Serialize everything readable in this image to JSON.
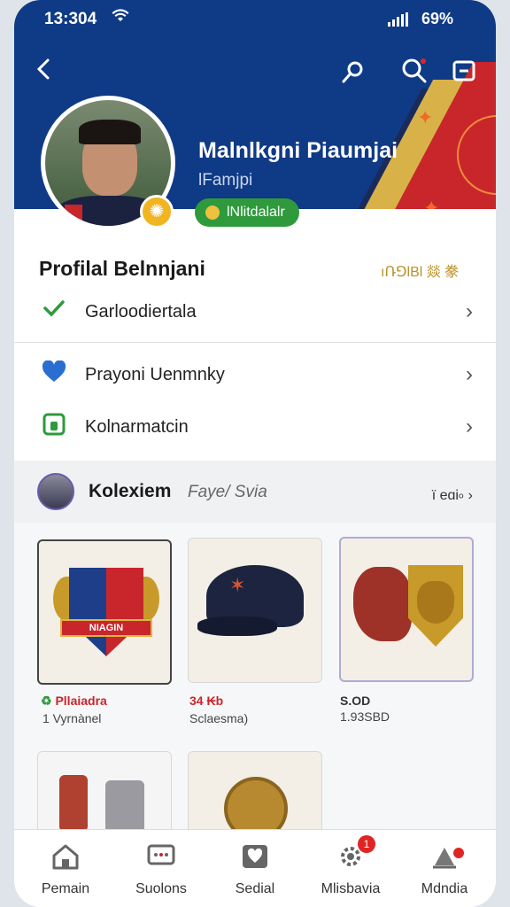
{
  "status_bar": {
    "time": "13:304",
    "battery": "69%"
  },
  "header": {
    "name": "Malnlkgni Piaumjai",
    "handle": "lFamjpi",
    "status_pill": "lNlitdalalr"
  },
  "profile_section": {
    "title": "Profilal Belnnjani",
    "meta": "ıՌ⅁lΒl 燚 豢",
    "items": [
      {
        "label": "Garloodiertala",
        "icon": "check-icon"
      },
      {
        "label": "Prayoni Uenmnky",
        "icon": "heart-icon"
      },
      {
        "label": "Kolnarmatcin",
        "icon": "lock-icon"
      }
    ]
  },
  "collection": {
    "title": "Kolexiem",
    "subtitle": "Faye/ Svia",
    "more": "ï eɑi৹"
  },
  "items": [
    {
      "price": "Pllaiadra",
      "name": "1  Vyrnànel",
      "price_color": "#c8262b"
    },
    {
      "price": "34 ₭b",
      "name": "Sclaesma)",
      "price_color": "#c8262b"
    },
    {
      "price": "S.OD",
      "name": "1.93SBD",
      "price_color": "#333333"
    }
  ],
  "shield_text": "NIAGIN",
  "tabs": [
    {
      "label": "Pemain",
      "icon": "home-icon"
    },
    {
      "label": "Suolons",
      "icon": "chat-icon"
    },
    {
      "label": "Sedial",
      "icon": "heart-box-icon"
    },
    {
      "label": "Mlisbavia",
      "icon": "gear-icon",
      "badge": "1"
    },
    {
      "label": "Mdndia",
      "icon": "alert-icon"
    }
  ]
}
